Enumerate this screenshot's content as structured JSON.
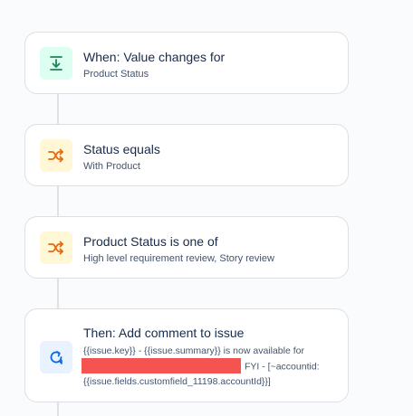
{
  "rule_steps": [
    {
      "kind": "trigger",
      "icon": "download-arrow-icon",
      "title": "When: Value changes for",
      "subtitle": "Product Status"
    },
    {
      "kind": "condition",
      "icon": "branch-shuffle-icon",
      "title": "Status equals",
      "subtitle": "With Product"
    },
    {
      "kind": "condition",
      "icon": "branch-shuffle-icon",
      "title": "Product Status is one of",
      "subtitle": "High level requirement review, Story review"
    },
    {
      "kind": "action",
      "icon": "refresh-comment-icon",
      "title": "Then: Add comment to issue",
      "comment_line1": "{{issue.key}} - {{issue.summary}} is now available for",
      "comment_line2": "FYI - [~accountid:",
      "comment_line3": "{{issue.fields.customfield_11198.accountId}}]"
    }
  ],
  "colors": {
    "trigger_icon": "#1f845a",
    "condition_icon": "#e56910",
    "action_icon": "#0c66e4",
    "redaction": "#f5534f"
  }
}
